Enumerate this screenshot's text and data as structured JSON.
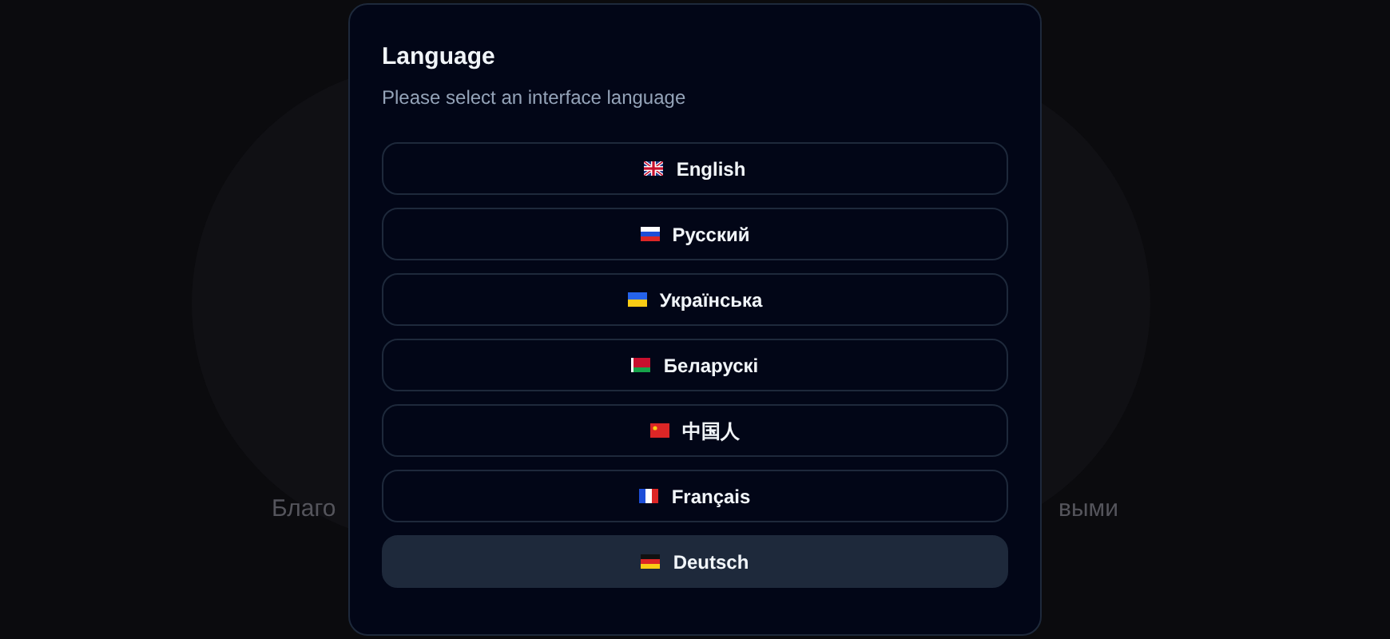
{
  "background": {
    "text_left": "Благо",
    "text_right": "выми"
  },
  "dialog": {
    "title": "Language",
    "subtitle": "Please select an interface language",
    "languages": [
      {
        "label": "English",
        "kind": "uk",
        "selected": false
      },
      {
        "label": "Русский",
        "kind": "russia",
        "selected": false
      },
      {
        "label": "Українська",
        "kind": "ukraine",
        "selected": false
      },
      {
        "label": "Беларускі",
        "kind": "belarus",
        "selected": false
      },
      {
        "label": "中国人",
        "kind": "china",
        "selected": false
      },
      {
        "label": "Français",
        "kind": "france",
        "selected": false
      },
      {
        "label": "Deutsch",
        "kind": "germany",
        "selected": true
      }
    ]
  }
}
